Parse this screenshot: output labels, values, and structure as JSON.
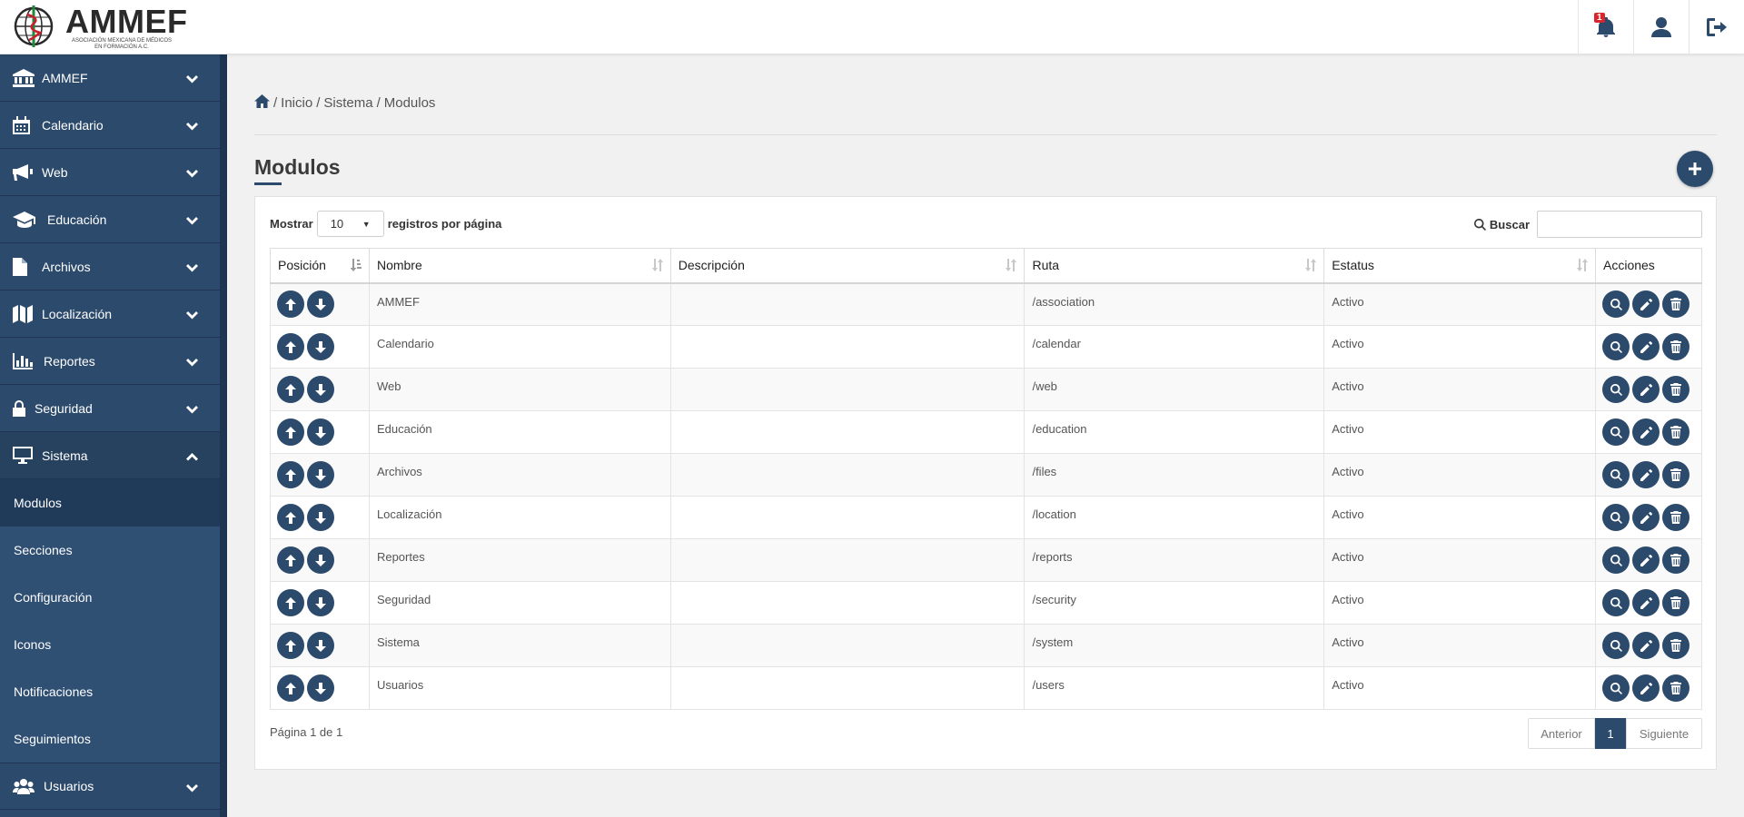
{
  "header": {
    "logo_name": "AMMEF",
    "logo_sub": "ASOCIACIÓN MEXICANA DE MÉDICOS EN FORMACIÓN A.C.",
    "notification_count": "1",
    "icons": [
      "bell-icon",
      "user-icon",
      "logout-icon"
    ]
  },
  "sidebar": {
    "items": [
      {
        "label": "AMMEF",
        "icon": "bank-icon"
      },
      {
        "label": "Calendario",
        "icon": "calendar-icon"
      },
      {
        "label": "Web",
        "icon": "megaphone-icon"
      },
      {
        "label": "Educación",
        "icon": "graduation-cap-icon"
      },
      {
        "label": "Archivos",
        "icon": "file-icon"
      },
      {
        "label": "Localización",
        "icon": "map-icon"
      },
      {
        "label": "Reportes",
        "icon": "bar-chart-icon"
      },
      {
        "label": "Seguridad",
        "icon": "lock-icon"
      },
      {
        "label": "Sistema",
        "icon": "desktop-icon"
      }
    ],
    "sub_items": [
      "Modulos",
      "Secciones",
      "Configuración",
      "Iconos",
      "Notificaciones",
      "Seguimientos"
    ],
    "last_item": {
      "label": "Usuarios",
      "icon": "users-icon"
    }
  },
  "breadcrumb": {
    "items": [
      "Inicio",
      "Sistema",
      "Modulos"
    ],
    "sep": "/"
  },
  "page": {
    "title": "Modulos"
  },
  "controls": {
    "show_label": "Mostrar",
    "page_size": "10",
    "per_page_label": "registros por página",
    "search_label": "Buscar",
    "search_value": ""
  },
  "table": {
    "headers": [
      "Posición",
      "Nombre",
      "Descripción",
      "Ruta",
      "Estatus",
      "Acciones"
    ],
    "rows": [
      {
        "nombre": "AMMEF",
        "descripcion": "",
        "ruta": "/association",
        "estatus": "Activo"
      },
      {
        "nombre": "Calendario",
        "descripcion": "",
        "ruta": "/calendar",
        "estatus": "Activo"
      },
      {
        "nombre": "Web",
        "descripcion": "",
        "ruta": "/web",
        "estatus": "Activo"
      },
      {
        "nombre": "Educación",
        "descripcion": "",
        "ruta": "/education",
        "estatus": "Activo"
      },
      {
        "nombre": "Archivos",
        "descripcion": "",
        "ruta": "/files",
        "estatus": "Activo"
      },
      {
        "nombre": "Localización",
        "descripcion": "",
        "ruta": "/location",
        "estatus": "Activo"
      },
      {
        "nombre": "Reportes",
        "descripcion": "",
        "ruta": "/reports",
        "estatus": "Activo"
      },
      {
        "nombre": "Seguridad",
        "descripcion": "",
        "ruta": "/security",
        "estatus": "Activo"
      },
      {
        "nombre": "Sistema",
        "descripcion": "",
        "ruta": "/system",
        "estatus": "Activo"
      },
      {
        "nombre": "Usuarios",
        "descripcion": "",
        "ruta": "/users",
        "estatus": "Activo"
      }
    ]
  },
  "pagination": {
    "info": "Página 1 de 1",
    "prev": "Anterior",
    "current": "1",
    "next": "Siguiente"
  },
  "colors": {
    "primary": "#2c4a6c",
    "sidebar_dark": "#1d3552",
    "badge": "#d9262c"
  }
}
